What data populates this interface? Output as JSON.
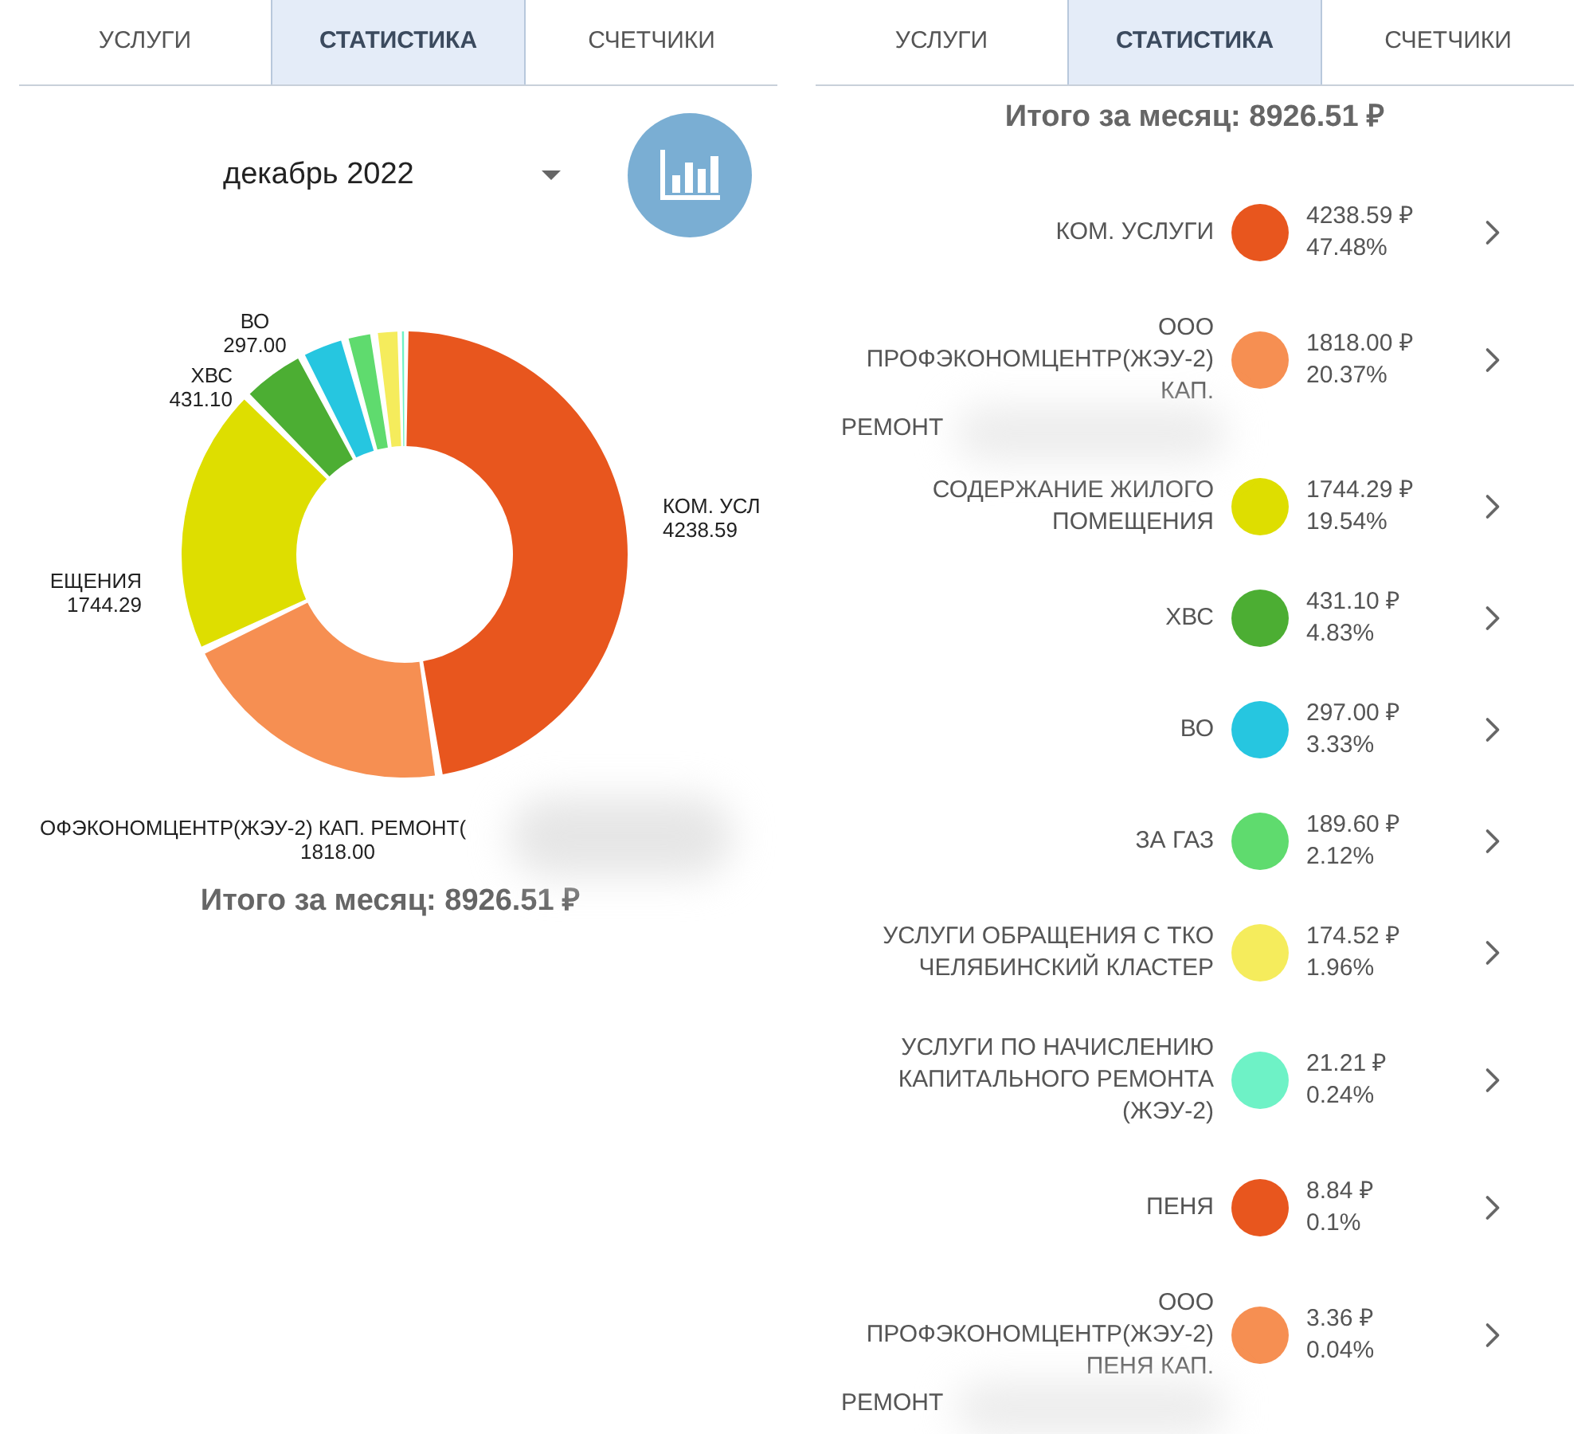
{
  "left": {
    "tabs": [
      {
        "label": "УСЛУГИ",
        "selected": false
      },
      {
        "label": "СТАТИСТИКА",
        "selected": true
      },
      {
        "label": "СЧЕТЧИКИ",
        "selected": false
      }
    ],
    "month_select": {
      "value": "декабрь 2022"
    },
    "chart_data": {
      "type": "donut",
      "categories": [
        "КОМ. УСЛ",
        "ОФЭКОНОМЦЕНТР(ЖЭУ-2) КАП. РЕМОНТ(",
        "ЕЩЕНИЯ",
        "ХВС",
        "ВО",
        null,
        null,
        null
      ],
      "values": [
        4238.59,
        1818.0,
        1744.29,
        431.1,
        297.0,
        189.6,
        174.52,
        21.21
      ],
      "value_labels": [
        "4238.59",
        "1818.00",
        "1744.29",
        "431.10",
        "297.00",
        null,
        null,
        null
      ],
      "colors": [
        "#e8561e",
        "#f68f52",
        "#dede00",
        "#4cae33",
        "#26c6e0",
        "#5fdb6e",
        "#f5ec5c",
        "#6ef2c6"
      ],
      "data_labels": true
    },
    "total": "Итого за месяц: 8926.51 ₽"
  },
  "right": {
    "tabs": [
      {
        "label": "УСЛУГИ",
        "selected": false
      },
      {
        "label": "СТАТИСТИКА",
        "selected": true
      },
      {
        "label": "СЧЕТЧИКИ",
        "selected": false
      }
    ],
    "total": "Итого за месяц: 8926.51 ₽",
    "rows": [
      {
        "label_lines": [
          "КОМ. УСЛУГИ"
        ],
        "color": "#e8561e",
        "amount": "4238.59 ₽",
        "percent": "47.48%"
      },
      {
        "label_lines": [
          "ООО",
          "ПРОФЭКОНОМЦЕНТР(ЖЭУ-2)",
          "КАП."
        ],
        "label_tail": "РЕМОНТ",
        "color": "#f68f52",
        "amount": "1818.00 ₽",
        "percent": "20.37%"
      },
      {
        "label_lines": [
          "СОДЕРЖАНИЕ ЖИЛОГО",
          "ПОМЕЩЕНИЯ"
        ],
        "color": "#dede00",
        "amount": "1744.29 ₽",
        "percent": "19.54%"
      },
      {
        "label_lines": [
          "ХВС"
        ],
        "color": "#4cae33",
        "amount": "431.10 ₽",
        "percent": "4.83%"
      },
      {
        "label_lines": [
          "ВО"
        ],
        "color": "#26c6e0",
        "amount": "297.00 ₽",
        "percent": "3.33%"
      },
      {
        "label_lines": [
          "ЗА ГАЗ"
        ],
        "color": "#5fdb6e",
        "amount": "189.60 ₽",
        "percent": "2.12%"
      },
      {
        "label_lines": [
          "УСЛУГИ ОБРАЩЕНИЯ С ТКО",
          "ЧЕЛЯБИНСКИЙ КЛАСТЕР"
        ],
        "color": "#f5ec5c",
        "amount": "174.52 ₽",
        "percent": "1.96%"
      },
      {
        "label_lines": [
          "УСЛУГИ ПО НАЧИСЛЕНИЮ",
          "КАПИТАЛЬНОГО РЕМОНТА",
          "(ЖЭУ-2)"
        ],
        "color": "#6ef2c6",
        "amount": "21.21 ₽",
        "percent": "0.24%"
      },
      {
        "label_lines": [
          "ПЕНЯ"
        ],
        "color": "#e8561e",
        "amount": "8.84 ₽",
        "percent": "0.1%"
      },
      {
        "label_lines": [
          "ООО",
          "ПРОФЭКОНОМЦЕНТР(ЖЭУ-2)",
          "ПЕНЯ КАП."
        ],
        "label_tail": "РЕМОНТ",
        "color": "#f68f52",
        "amount": "3.36 ₽",
        "percent": "0.04%"
      }
    ]
  }
}
